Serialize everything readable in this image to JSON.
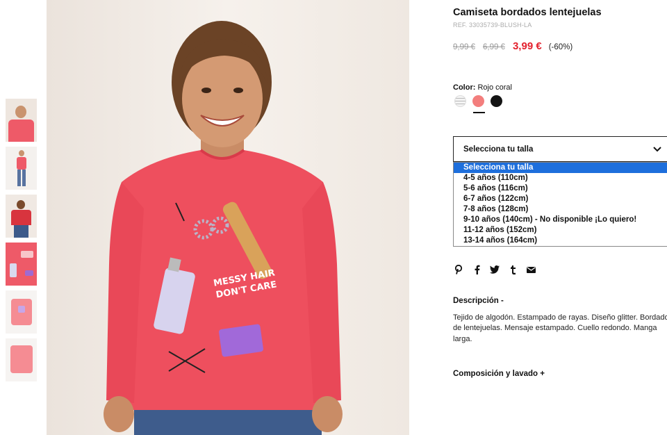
{
  "product": {
    "title": "Camiseta bordados lentejuelas",
    "ref": "REF. 33035739-BLUSH-LA",
    "price_original": "9,99 €",
    "price_previous": "6,99 €",
    "price_current": "3,99 €",
    "discount": "(-60%)"
  },
  "color": {
    "label": "Color:",
    "value": "Rojo coral",
    "swatches": [
      "striped",
      "coral",
      "black"
    ],
    "selected": "coral"
  },
  "size": {
    "placeholder": "Selecciona tu talla",
    "options": [
      "Selecciona tu talla",
      "4-5 años (110cm)",
      "5-6 años (116cm)",
      "6-7 años (122cm)",
      "7-8 años (128cm)",
      "9-10 años (140cm) - No disponible ¡Lo quiero!",
      "11-12 años (152cm)",
      "13-14 años (164cm)"
    ]
  },
  "share": {
    "icons": [
      "pinterest-icon",
      "facebook-icon",
      "twitter-icon",
      "tumblr-icon",
      "email-icon"
    ]
  },
  "description": {
    "heading": "Descripción -",
    "text": "Tejido de algodón. Estampado de rayas. Diseño glitter. Bordado de lentejuelas. Mensaje estampado. Cuello redondo. Manga larga."
  },
  "composition": {
    "heading": "Composición y lavado +"
  },
  "image": {
    "print_text": "MESSY HAIR DON'T CARE"
  },
  "colors": {
    "price_red": "#e3202d",
    "shirt": "#ee4f5e",
    "select_highlight": "#1e6fdc"
  }
}
